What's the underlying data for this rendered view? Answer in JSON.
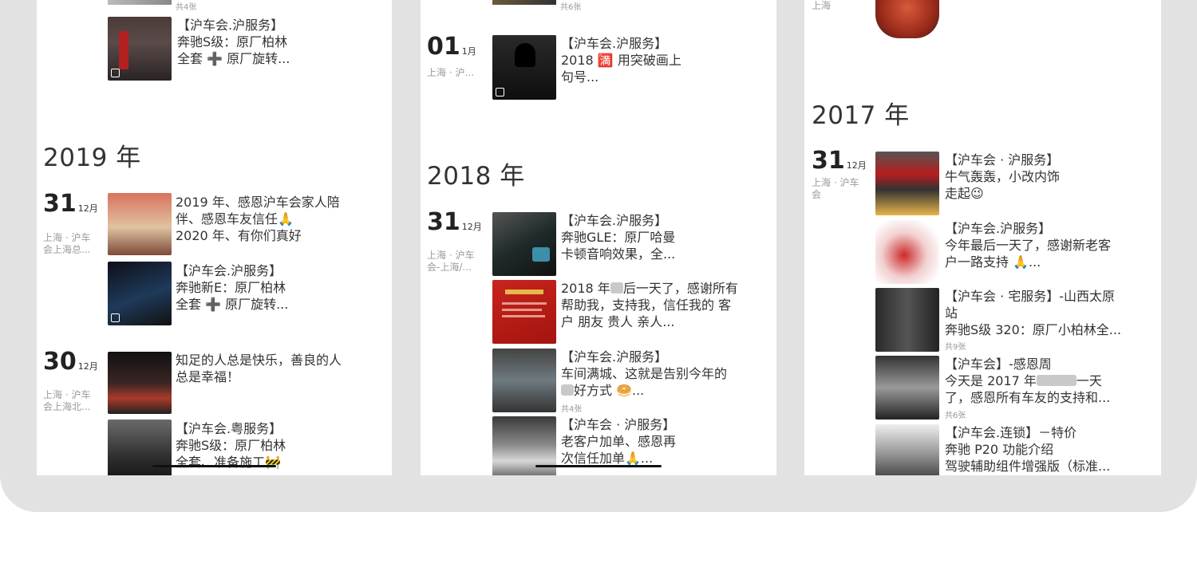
{
  "col1": {
    "top_count": "共4张",
    "top_post": {
      "l1": "【沪车会.沪服务】",
      "l2": "奔驰S级：原厂柏林",
      "l3": "全套 ➕ 原厂旋转..."
    },
    "year": "2019 年",
    "group1": {
      "day": "31",
      "month": "12月",
      "loc1": "上海 · 沪车",
      "loc2": "会上海总...",
      "post1": {
        "l1": "2019 年、感恩沪车会家人陪",
        "l2": "伴、感恩车友信任🙏",
        "l3": "2020 年、有你们真好"
      },
      "post2": {
        "l1": "【沪车会.沪服务】",
        "l2": "奔驰新E：原厂柏林",
        "l3": "全套 ➕ 原厂旋转..."
      }
    },
    "group2": {
      "day": "30",
      "month": "12月",
      "loc1": "上海 · 沪车",
      "loc2": "会上海北...",
      "post1": {
        "l1": "知足的人总是快乐，善良的人",
        "l2": "总是幸福！"
      },
      "post2": {
        "l1": "【沪车会.粤服务】",
        "l2": "奔驰S级：原厂柏林",
        "l3": "全套、准备施工🚧"
      }
    }
  },
  "col2": {
    "top_count": "共6张",
    "group0": {
      "day": "01",
      "month": "1月",
      "loc1": "上海 · 沪...",
      "post1": {
        "l1": "【沪车会.沪服务】",
        "l2": "2018 🈵 用突破画上",
        "l3": "句号..."
      }
    },
    "year": "2018 年",
    "group1": {
      "day": "31",
      "month": "12月",
      "loc1": "上海 · 沪车",
      "loc2": "会-上海/...",
      "post1": {
        "l1": "【沪车会.沪服务】",
        "l2": "奔驰GLE：原厂哈曼",
        "l3": "卡顿音响效果，全..."
      },
      "post2": {
        "l1a": "2018 年",
        "l1b": "后一天了，感谢所有",
        "l2": "帮助我，支持我，信任我的 客",
        "l3": "户 朋友 贵人 亲人..."
      },
      "post3": {
        "l1": "【沪车会.沪服务】",
        "l2": "车间满城、这就是告别今年的",
        "l3": "好方式 🥯...",
        "count": "共4张"
      },
      "post4": {
        "l1": "【沪车会 · 沪服务】",
        "l2": "老客户加单、感恩再",
        "l3": "次信任加单🙏..."
      }
    }
  },
  "col3": {
    "top_loc": "上海",
    "year": "2017 年",
    "group1": {
      "day": "31",
      "month": "12月",
      "loc1": "上海 · 沪车",
      "loc2": "会",
      "post1": {
        "l1": "【沪车会 · 沪服务】",
        "l2": "牛气轰轰，小改内饰",
        "l3": "走起😉"
      },
      "post2": {
        "l1": "【沪车会.沪服务】",
        "l2": "今年最后一天了，感谢新老客",
        "l3": "户一路支持 🙏..."
      },
      "post3": {
        "l1": "【沪车会 · 宅服务】-山西太原",
        "l2": "站",
        "l3": "奔驰S级 320：原厂小柏林全...",
        "count": "共9张"
      },
      "post4": {
        "l1": "【沪车会】-感恩周",
        "l2a": "今天是 2017 年",
        "l2b": "一天",
        "l3": "了，感恩所有车友的支持和...",
        "count": "共6张"
      },
      "post5": {
        "l1": "【沪车会.连锁】－特价",
        "l2": "奔驰 P20 功能介绍",
        "l3": "驾驶辅助组件增强版（标准..."
      }
    }
  },
  "colors": {
    "frame": "#e2e2e2",
    "panel": "#ffffff",
    "text": "#333333",
    "muted": "#9a9a9a"
  },
  "icons": [
    "multi-photo-icon",
    "construction-emoji-icon",
    "pray-emoji-icon"
  ]
}
